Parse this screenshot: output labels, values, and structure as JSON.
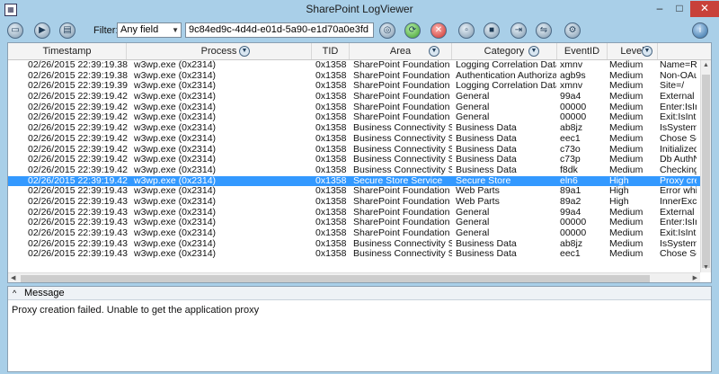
{
  "window": {
    "title": "SharePoint LogViewer",
    "app_icon": "sp-logviewer-icon",
    "min": "–",
    "max": "□",
    "close": "✕"
  },
  "toolbar": {
    "filter_label": "Filter:",
    "filter_field": "Any field",
    "filter_value": "9c84ed9c-4d4d-e01d-5a90-e1d70a0e3fd"
  },
  "columns": [
    "Timestamp",
    "Process",
    "TID",
    "Area",
    "Category",
    "EventID",
    "Level"
  ],
  "rows": [
    [
      "02/26/2015 22:39:19.38",
      "w3wp.exe (0x2314)",
      "0x1358",
      "SharePoint Foundation",
      "Logging Correlation Data",
      "xmnv",
      "Medium",
      "Name=Req"
    ],
    [
      "02/26/2015 22:39:19.38",
      "w3wp.exe (0x2314)",
      "0x1358",
      "SharePoint Foundation",
      "Authentication Authorizati",
      "agb9s",
      "Medium",
      "Non-OAuth"
    ],
    [
      "02/26/2015 22:39:19.39",
      "w3wp.exe (0x2314)",
      "0x1358",
      "SharePoint Foundation",
      "Logging Correlation Data",
      "xmnv",
      "Medium",
      "Site=/"
    ],
    [
      "02/26/2015 22:39:19.42",
      "w3wp.exe (0x2314)",
      "0x1358",
      "SharePoint Foundation",
      "General",
      "99a4",
      "Medium",
      "External Li:"
    ],
    [
      "02/26/2015 22:39:19.42",
      "w3wp.exe (0x2314)",
      "0x1358",
      "SharePoint Foundation",
      "General",
      "00000",
      "Medium",
      "Enter:IsInt"
    ],
    [
      "02/26/2015 22:39:19.42",
      "w3wp.exe (0x2314)",
      "0x1358",
      "SharePoint Foundation",
      "General",
      "00000",
      "Medium",
      "Exit:IsIntra"
    ],
    [
      "02/26/2015 22:39:19.42",
      "w3wp.exe (0x2314)",
      "0x1358",
      "Business Connectivity Ser",
      "Business Data",
      "ab8jz",
      "Medium",
      "IsSystemTy"
    ],
    [
      "02/26/2015 22:39:19.42",
      "w3wp.exe (0x2314)",
      "0x1358",
      "Business Connectivity Ser",
      "Business Data",
      "eec1",
      "Medium",
      "Chose SqlS"
    ],
    [
      "02/26/2015 22:39:19.42",
      "w3wp.exe (0x2314)",
      "0x1358",
      "Business Connectivity Ser",
      "Business Data",
      "c73o",
      "Medium",
      "Initialized I"
    ],
    [
      "02/26/2015 22:39:19.42",
      "w3wp.exe (0x2314)",
      "0x1358",
      "Business Connectivity Ser",
      "Business Data",
      "c73p",
      "Medium",
      "Db AuthN N"
    ],
    [
      "02/26/2015 22:39:19.42",
      "w3wp.exe (0x2314)",
      "0x1358",
      "Business Connectivity Ser",
      "Business Data",
      "f8dk",
      "Medium",
      "Checking fo"
    ],
    [
      "02/26/2015 22:39:19.42",
      "w3wp.exe (0x2314)",
      "0x1358",
      "Secure Store Service",
      "Secure Store",
      "eln6",
      "High",
      "Proxy creat"
    ],
    [
      "02/26/2015 22:39:19.43",
      "w3wp.exe (0x2314)",
      "0x1358",
      "SharePoint Foundation",
      "Web Parts",
      "89a1",
      "High",
      "Error while"
    ],
    [
      "02/26/2015 22:39:19.43",
      "w3wp.exe (0x2314)",
      "0x1358",
      "SharePoint Foundation",
      "Web Parts",
      "89a2",
      "High",
      "InnerExcep"
    ],
    [
      "02/26/2015 22:39:19.43",
      "w3wp.exe (0x2314)",
      "0x1358",
      "SharePoint Foundation",
      "General",
      "99a4",
      "Medium",
      "External Li:"
    ],
    [
      "02/26/2015 22:39:19.43",
      "w3wp.exe (0x2314)",
      "0x1358",
      "SharePoint Foundation",
      "General",
      "00000",
      "Medium",
      "Enter:IsInt"
    ],
    [
      "02/26/2015 22:39:19.43",
      "w3wp.exe (0x2314)",
      "0x1358",
      "SharePoint Foundation",
      "General",
      "00000",
      "Medium",
      "Exit:IsIntra"
    ],
    [
      "02/26/2015 22:39:19.43",
      "w3wp.exe (0x2314)",
      "0x1358",
      "Business Connectivity Ser",
      "Business Data",
      "ab8jz",
      "Medium",
      "IsSystemTy"
    ],
    [
      "02/26/2015 22:39:19.43",
      "w3wp.exe (0x2314)",
      "0x1358",
      "Business Connectivity Ser",
      "Business Data",
      "eec1",
      "Medium",
      "Chose SqlS"
    ]
  ],
  "selected_row": 11,
  "message": {
    "title": "Message",
    "text": "Proxy creation failed. Unable to get the application proxy"
  }
}
